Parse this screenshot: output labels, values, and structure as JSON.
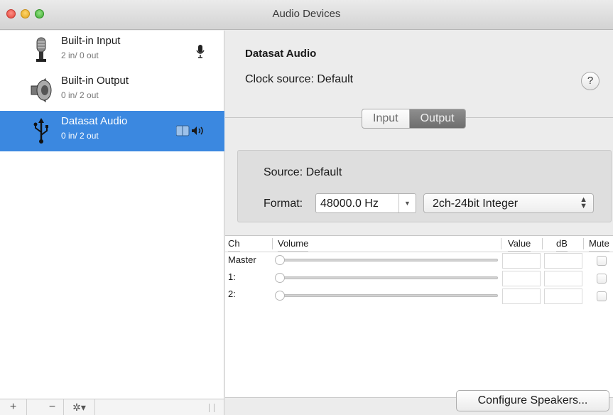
{
  "window": {
    "title": "Audio Devices"
  },
  "devices": [
    {
      "name": "Built-in Input",
      "io": "2 in/ 0 out",
      "icon": "microphone-icon",
      "badge": "microphone-icon"
    },
    {
      "name": "Built-in Output",
      "io": "0 in/ 2 out",
      "icon": "speaker-icon"
    },
    {
      "name": "Datasat Audio",
      "io": "0 in/ 2 out",
      "icon": "usb-icon",
      "badge": "finder-speaker-icon",
      "selected": true
    }
  ],
  "sidebar_bottom": {
    "add": "+",
    "remove": "−",
    "gear": "✲▾"
  },
  "detail": {
    "device_title": "Datasat Audio",
    "clock_source": "Clock source: Default",
    "help": "?",
    "tabs": {
      "input": "Input",
      "output": "Output",
      "selected": "Output"
    },
    "source": "Source: Default",
    "format_label": "Format:",
    "sample_rate": "48000.0 Hz",
    "bit_format": "2ch-24bit Integer"
  },
  "table": {
    "headers": {
      "ch": "Ch",
      "volume": "Volume",
      "value": "Value",
      "db": "dB",
      "mute": "Mute"
    },
    "rows": [
      {
        "label": "Master"
      },
      {
        "label": "1:"
      },
      {
        "label": "2:"
      }
    ]
  },
  "configure_button": "Configure Speakers...",
  "colors": {
    "selection": "#3b88e0"
  }
}
